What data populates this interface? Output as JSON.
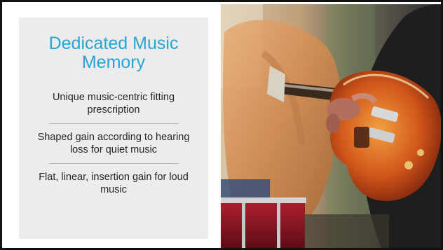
{
  "slide": {
    "title": "Dedicated Music Memory",
    "bullets": [
      "Unique music-centric fitting prescription",
      "Shaped gain according to hearing loss for quiet music",
      "Flat, linear, insertion gain for loud music"
    ]
  },
  "photo": {
    "icon": "guitar-player-photo"
  },
  "colors": {
    "title": "#25a5d6",
    "panel": "#ececec",
    "text": "#262626",
    "frame": "#111111"
  }
}
